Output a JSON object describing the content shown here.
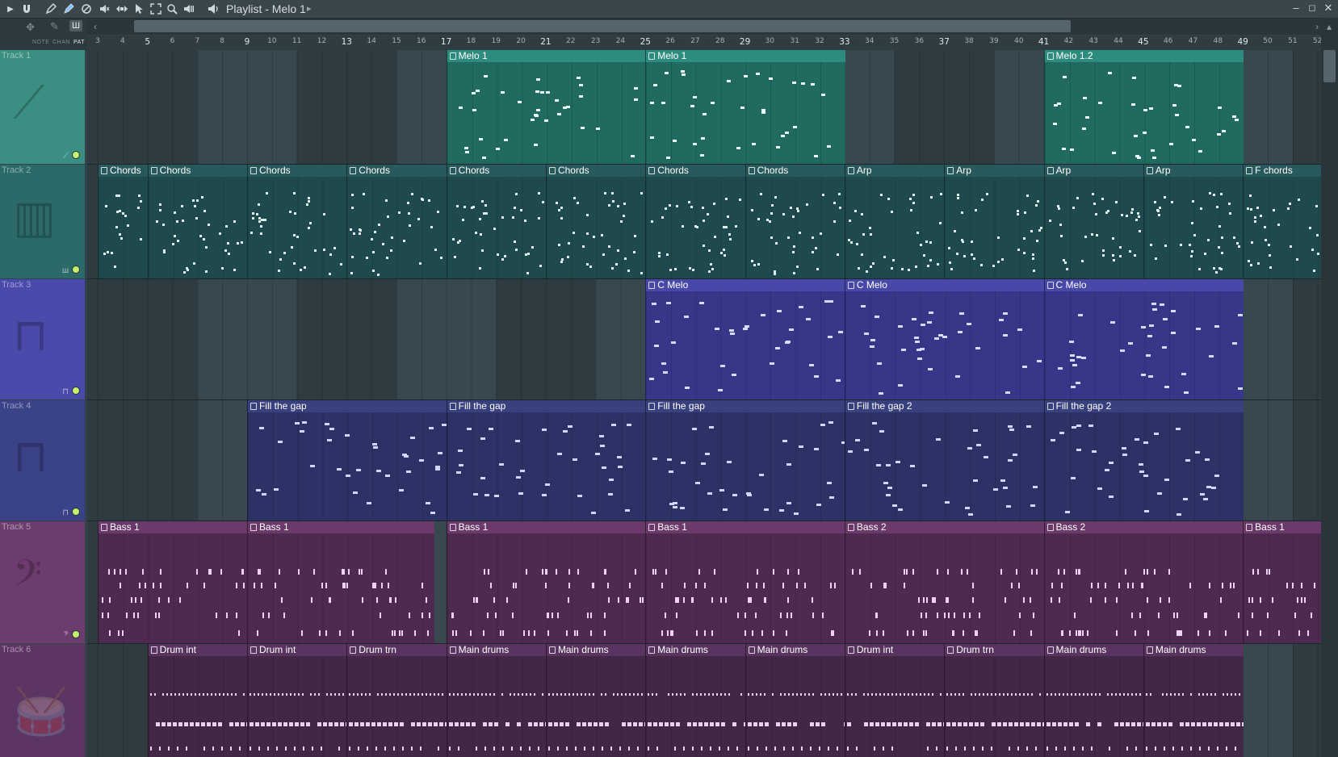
{
  "window": {
    "title": "Playlist - Melo 1",
    "title_arrow": "▸",
    "controls": {
      "minimize": "–",
      "maximize": "◻",
      "close": "✕"
    }
  },
  "toolbar_icons": [
    "play-arrow-icon",
    "magnet-icon",
    "draw-icon",
    "paint-icon",
    "delete-icon",
    "mute-icon",
    "slip-icon",
    "select-icon",
    "zoom-select-icon",
    "zoom-icon",
    "playback-icon",
    "speaker-icon"
  ],
  "mini_tabs": {
    "note": "NOTE",
    "chan": "CHAN",
    "pat": "PAT"
  },
  "ruler": {
    "first_bar": 3,
    "last_bar": 52,
    "major_bars": [
      5,
      9,
      13,
      17,
      21,
      25,
      29,
      33,
      37,
      41,
      45,
      49
    ]
  },
  "colors": {
    "teal": "#2e8c7e",
    "teal_dark": "#216a60",
    "chords": "#28595d",
    "chords_dark": "#1f4a4d",
    "indigo": "#4848a8",
    "indigo_dark": "#37378a",
    "navy": "#38407e",
    "navy_dark": "#2c3266",
    "plum": "#6b3a6b",
    "plum_dark": "#4f2a50",
    "drums": "#5a3460",
    "drums_dark": "#432747"
  },
  "tracks": [
    {
      "name": "Track 1",
      "icon": "automation-icon",
      "glyph": "⟋",
      "small": "⟋",
      "color": "#3a8f82",
      "clips": [
        {
          "label": "Melo 1",
          "start": 17,
          "end": 25,
          "style": "teal"
        },
        {
          "label": "Melo 1",
          "start": 25,
          "end": 33,
          "style": "teal"
        },
        {
          "label": "Melo 1.2",
          "start": 41,
          "end": 49,
          "style": "teal"
        }
      ]
    },
    {
      "name": "Track 2",
      "icon": "piano-icon",
      "glyph": "▥",
      "small": "ш",
      "color": "#2c6a6a",
      "clips": [
        {
          "label": "Chords",
          "start": 3,
          "end": 5,
          "style": "chords"
        },
        {
          "label": "Chords",
          "start": 5,
          "end": 9,
          "style": "chords"
        },
        {
          "label": "Chords",
          "start": 9,
          "end": 13,
          "style": "chords"
        },
        {
          "label": "Chords",
          "start": 13,
          "end": 17,
          "style": "chords"
        },
        {
          "label": "Chords",
          "start": 17,
          "end": 21,
          "style": "chords"
        },
        {
          "label": "Chords",
          "start": 21,
          "end": 25,
          "style": "chords"
        },
        {
          "label": "Chords",
          "start": 25,
          "end": 29,
          "style": "chords"
        },
        {
          "label": "Chords",
          "start": 29,
          "end": 33,
          "style": "chords"
        },
        {
          "label": "Arp",
          "start": 33,
          "end": 37,
          "style": "chords"
        },
        {
          "label": "Arp",
          "start": 37,
          "end": 41,
          "style": "chords"
        },
        {
          "label": "Arp",
          "start": 41,
          "end": 45,
          "style": "chords"
        },
        {
          "label": "Arp",
          "start": 45,
          "end": 49,
          "style": "chords"
        },
        {
          "label": "F chords",
          "start": 49,
          "end": 53,
          "style": "chords"
        }
      ]
    },
    {
      "name": "Track 3",
      "icon": "square-wave-icon",
      "glyph": "⊓",
      "small": "⊓",
      "color": "#4a4aaa",
      "clips": [
        {
          "label": "C Melo",
          "start": 25,
          "end": 33,
          "style": "indigo"
        },
        {
          "label": "C Melo",
          "start": 33,
          "end": 41,
          "style": "indigo"
        },
        {
          "label": "C Melo",
          "start": 41,
          "end": 49,
          "style": "indigo"
        }
      ]
    },
    {
      "name": "Track 4",
      "icon": "square-wave-icon",
      "glyph": "⊓",
      "small": "⊓",
      "color": "#3b4388",
      "clips": [
        {
          "label": "Fill the gap",
          "start": 9,
          "end": 17,
          "style": "navy"
        },
        {
          "label": "Fill the gap",
          "start": 17,
          "end": 25,
          "style": "navy"
        },
        {
          "label": "Fill the gap",
          "start": 25,
          "end": 33,
          "style": "navy"
        },
        {
          "label": "Fill the gap 2",
          "start": 33,
          "end": 41,
          "style": "navy"
        },
        {
          "label": "Fill the gap 2",
          "start": 41,
          "end": 49,
          "style": "navy"
        }
      ]
    },
    {
      "name": "Track 5",
      "icon": "bass-clef-icon",
      "glyph": "𝄢",
      "small": "𝄢",
      "color": "#6d3c6f",
      "clips": [
        {
          "label": "Bass 1",
          "start": 3,
          "end": 9,
          "style": "plum"
        },
        {
          "label": "Bass 1",
          "start": 9,
          "end": 16.5,
          "style": "plum"
        },
        {
          "label": "Bass 1",
          "start": 17,
          "end": 25,
          "style": "plum"
        },
        {
          "label": "Bass 1",
          "start": 25,
          "end": 33,
          "style": "plum"
        },
        {
          "label": "Bass 2",
          "start": 33,
          "end": 41,
          "style": "plum"
        },
        {
          "label": "Bass 2",
          "start": 41,
          "end": 49,
          "style": "plum"
        },
        {
          "label": "Bass 1",
          "start": 49,
          "end": 53,
          "style": "plum"
        }
      ]
    },
    {
      "name": "Track 6",
      "icon": "drum-icon",
      "glyph": "🥁",
      "small": "⟋",
      "color": "#5c3562",
      "clips": [
        {
          "label": "Drum int",
          "start": 5,
          "end": 9,
          "style": "drums"
        },
        {
          "label": "Drum int",
          "start": 9,
          "end": 13,
          "style": "drums"
        },
        {
          "label": "Drum trn",
          "start": 13,
          "end": 17,
          "style": "drums"
        },
        {
          "label": "Main drums",
          "start": 17,
          "end": 21,
          "style": "drums"
        },
        {
          "label": "Main drums",
          "start": 21,
          "end": 25,
          "style": "drums"
        },
        {
          "label": "Main drums",
          "start": 25,
          "end": 29,
          "style": "drums"
        },
        {
          "label": "Main drums",
          "start": 29,
          "end": 33,
          "style": "drums"
        },
        {
          "label": "Drum int",
          "start": 33,
          "end": 37,
          "style": "drums"
        },
        {
          "label": "Drum trn",
          "start": 37,
          "end": 41,
          "style": "drums"
        },
        {
          "label": "Main drums",
          "start": 41,
          "end": 45,
          "style": "drums"
        },
        {
          "label": "Main drums",
          "start": 45,
          "end": 49,
          "style": "drums"
        }
      ]
    }
  ]
}
